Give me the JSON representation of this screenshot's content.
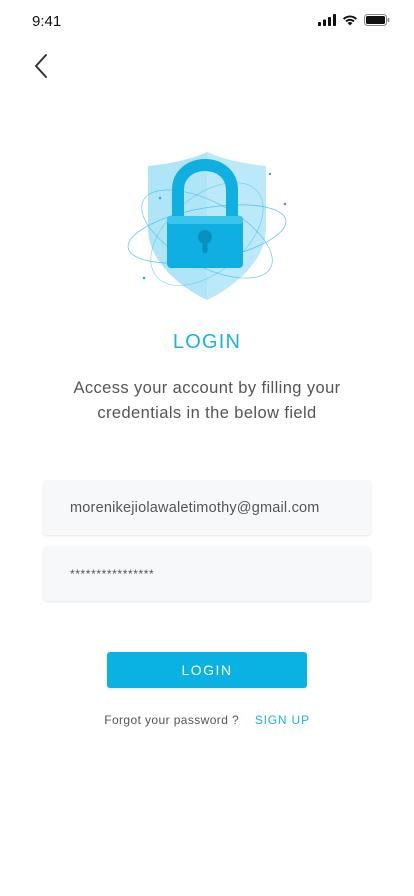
{
  "status_bar": {
    "time": "9:41"
  },
  "header": {
    "back_icon": "chevron-left-icon"
  },
  "illustration": {
    "icon": "shield-lock-icon",
    "colors": {
      "shield": "#a7e2f7",
      "lock": "#0fb0e1",
      "lock_dark": "#0a8fbf"
    }
  },
  "login": {
    "title": "LOGIN",
    "subtitle": "Access your account by filling your credentials in the below field"
  },
  "form": {
    "email_value": "morenikejiolawaletimothy@gmail.com",
    "password_value": "****************",
    "submit_label": "LOGIN"
  },
  "footer": {
    "forgot_label": "Forgot your password ?",
    "signup_label": "SIGN UP"
  },
  "colors": {
    "accent": "#0ab2e3",
    "text": "#555555"
  }
}
